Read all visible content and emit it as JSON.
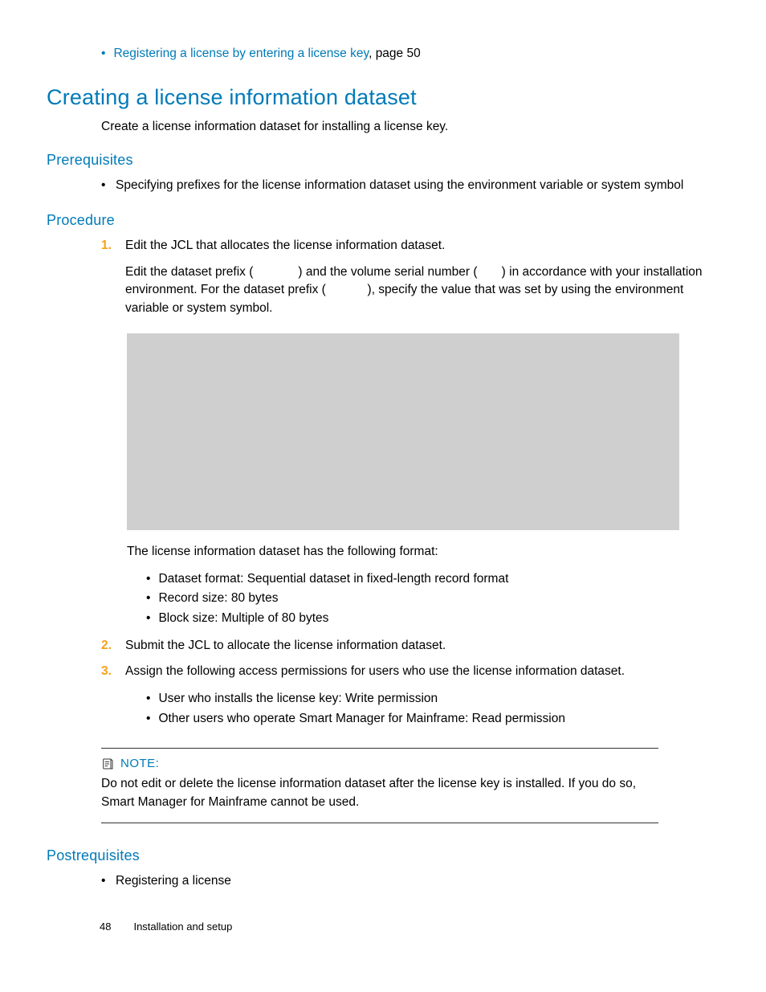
{
  "topRef": {
    "linkText": "Registering a license by entering a license key",
    "suffix": ", page 50"
  },
  "title": "Creating a license information dataset",
  "intro": "Create a license information dataset for installing a license key.",
  "prereq": {
    "heading": "Prerequisites",
    "item": "Specifying prefixes for the license information dataset using the environment variable or system symbol"
  },
  "procedure": {
    "heading": "Procedure",
    "steps": [
      {
        "num": "1.",
        "lead": "Edit the JCL that allocates the license information dataset.",
        "detail_a": "Edit the dataset prefix (",
        "detail_b": ") and the volume serial number (",
        "detail_c": ") in accordance with your installation environment. For the dataset prefix (",
        "detail_d": "), specify the value that was set by using the environment variable or system symbol.",
        "afterCode": "The license information dataset has the following format:",
        "bullets": [
          "Dataset format: Sequential dataset in fixed-length record format",
          "Record size: 80 bytes",
          "Block size: Multiple of 80 bytes"
        ]
      },
      {
        "num": "2.",
        "lead": "Submit the JCL to allocate the license information dataset."
      },
      {
        "num": "3.",
        "lead": "Assign the following access permissions for users who use the license information dataset.",
        "bullets": [
          "User who installs the license key: Write permission",
          "Other users who operate Smart Manager for Mainframe: Read permission"
        ]
      }
    ]
  },
  "note": {
    "label": "NOTE:",
    "body": "Do not edit or delete the license information dataset after the license key is installed. If you do so, Smart Manager for Mainframe cannot be used."
  },
  "postreq": {
    "heading": "Postrequisites",
    "item": "Registering a license"
  },
  "footer": {
    "page": "48",
    "title": "Installation and setup"
  }
}
